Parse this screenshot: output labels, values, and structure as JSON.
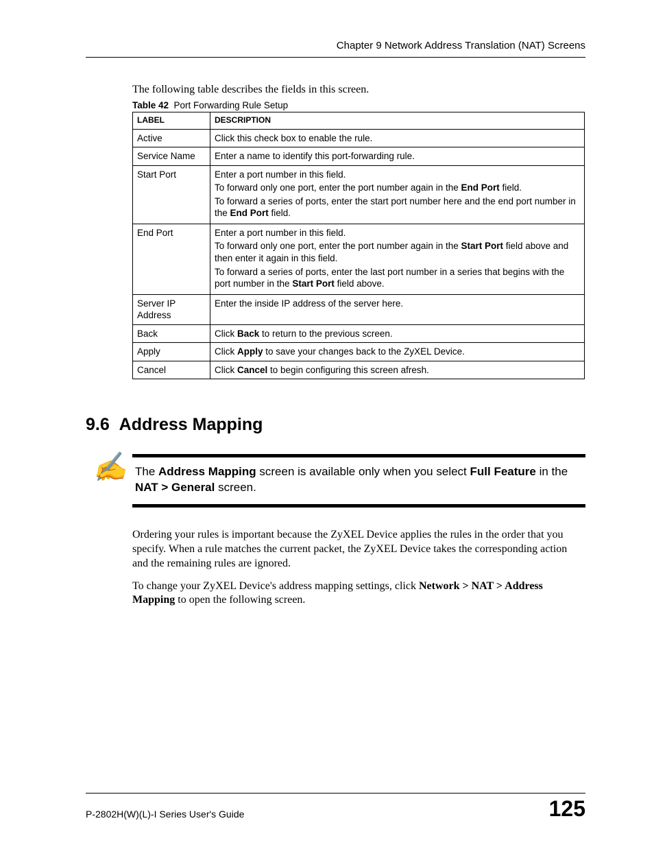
{
  "header": {
    "chapter": "Chapter 9 Network Address Translation (NAT) Screens"
  },
  "intro": "The following table describes the fields in this screen.",
  "table": {
    "caption_label": "Table 42",
    "caption_text": "Port Forwarding Rule Setup",
    "headers": {
      "label": "LABEL",
      "description": "DESCRIPTION"
    },
    "rows": [
      {
        "label": "Active",
        "desc": "Click this check box to enable the rule."
      },
      {
        "label": "Service Name",
        "desc": "Enter a name to identify this port-forwarding rule."
      },
      {
        "label": "Start Port",
        "desc_p1": "Enter a port number in this field.",
        "desc_p2a": "To forward only one port, enter the port number again in the ",
        "desc_p2b": "End Port",
        "desc_p2c": " field.",
        "desc_p3a": "To forward a series of ports, enter the start port number here and the end port number in the ",
        "desc_p3b": "End Port",
        "desc_p3c": " field."
      },
      {
        "label": "End Port",
        "desc_p1": "Enter a port number in this field.",
        "desc_p2a": "To forward only one port, enter the port number again in the ",
        "desc_p2b": "Start Port",
        "desc_p2c": " field above and then enter it again in this field.",
        "desc_p3a": "To forward a series of ports, enter the last port number in a series that begins with the port number in the ",
        "desc_p3b": "Start Port",
        "desc_p3c": " field above."
      },
      {
        "label": "Server IP Address",
        "desc": "Enter the inside IP address of the server here."
      },
      {
        "label": "Back",
        "desc_a": "Click ",
        "desc_b": "Back",
        "desc_c": " to return to the previous screen."
      },
      {
        "label": "Apply",
        "desc_a": "Click ",
        "desc_b": "Apply",
        "desc_c": " to save your changes back to the ZyXEL Device."
      },
      {
        "label": "Cancel",
        "desc_a": "Click ",
        "desc_b": "Cancel",
        "desc_c": " to begin configuring this screen afresh."
      }
    ]
  },
  "section": {
    "number": "9.6",
    "title": "Address Mapping"
  },
  "note": {
    "t1": "The ",
    "b1": "Address Mapping",
    "t2": " screen is available only when you select ",
    "b2": "Full Feature",
    "t3": " in the ",
    "b3": "NAT > General",
    "t4": " screen."
  },
  "para1": "Ordering your rules is important because the ZyXEL Device applies the rules in the order that you specify. When a rule matches the current packet, the ZyXEL Device takes the corresponding action and the remaining rules are ignored.",
  "para2": {
    "t1": "To change your ZyXEL Device's address mapping settings, click ",
    "b1": "Network > NAT > Address Mapping",
    "t2": " to open the following screen."
  },
  "footer": {
    "guide": "P-2802H(W)(L)-I Series User's Guide",
    "page": "125"
  }
}
